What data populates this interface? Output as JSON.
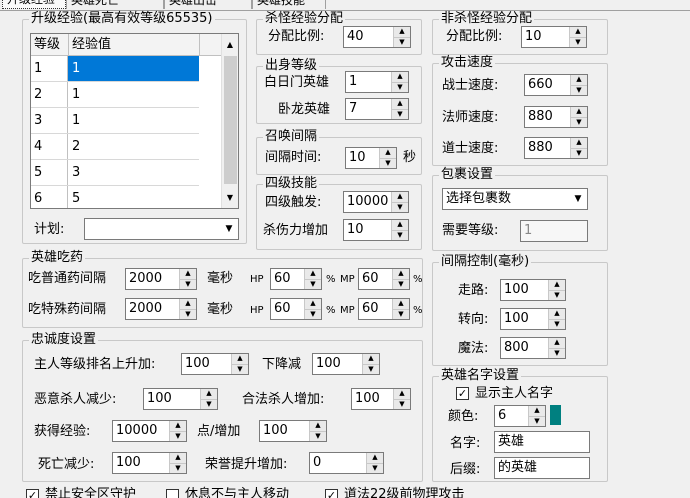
{
  "tabs": [
    "升级经验",
    "英雄死亡",
    "英雄出击",
    "英雄技能"
  ],
  "level_exp": {
    "group_label": "升级经验(最高有效等级65535)",
    "columns": [
      "等级",
      "经验值"
    ],
    "rows": [
      [
        "1",
        "1"
      ],
      [
        "2",
        "1"
      ],
      [
        "3",
        "1"
      ],
      [
        "4",
        "2"
      ],
      [
        "5",
        "3"
      ],
      [
        "6",
        "5"
      ]
    ],
    "plan_label": "计划:",
    "plan_value": ""
  },
  "kill_monster": {
    "group_label": "杀怪经验分配",
    "ratio_label": "分配比例:",
    "ratio_value": "40"
  },
  "non_kill": {
    "group_label": "非杀怪经验分配",
    "ratio_label": "分配比例:",
    "ratio_value": "10"
  },
  "origin_level": {
    "group_label": "出身等级",
    "baiyue_label": "白日门英雄",
    "baiyue_value": "1",
    "wolong_label": "卧龙英雄",
    "wolong_value": "7"
  },
  "summon": {
    "group_label": "召唤间隔",
    "interval_label": "间隔时间:",
    "interval_value": "10",
    "unit": "秒"
  },
  "skill4": {
    "group_label": "四级技能",
    "trigger_label": "四级触发:",
    "trigger_value": "10000",
    "damage_label": "杀伤力增加",
    "damage_value": "10"
  },
  "attack_speed": {
    "group_label": "攻击速度",
    "warrior_label": "战士速度:",
    "warrior_value": "660",
    "mage_label": "法师速度:",
    "mage_value": "880",
    "taoist_label": "道士速度:",
    "taoist_value": "880"
  },
  "package": {
    "group_label": "包裹设置",
    "select_value": "选择包裹数",
    "level_label": "需要等级:",
    "level_value": "1"
  },
  "potion": {
    "group_label": "英雄吃药",
    "normal_label": "吃普通药间隔",
    "normal_value": "2000",
    "special_label": "吃特殊药间隔",
    "special_value": "2000",
    "ms": "毫秒",
    "hp": "HP",
    "mp": "MP",
    "pct": "%",
    "normal_hp": "60",
    "normal_mp": "60",
    "special_hp": "60",
    "special_mp": "60"
  },
  "interval_ctrl": {
    "group_label": "间隔控制(毫秒)",
    "walk_label": "走路:",
    "walk_value": "100",
    "turn_label": "转向:",
    "turn_value": "100",
    "magic_label": "魔法:",
    "magic_value": "800"
  },
  "loyalty": {
    "group_label": "忠诚度设置",
    "rank_up_label": "主人等级排名上升加:",
    "rank_up_value": "100",
    "rank_down_label": "下降减",
    "rank_down_value": "100",
    "evil_label": "恶意杀人减少:",
    "evil_value": "100",
    "legal_label": "合法杀人增加:",
    "legal_value": "100",
    "exp_label": "获得经验:",
    "exp_value": "10000",
    "per_label": "点/增加",
    "per_value": "100",
    "death_label": "死亡减少:",
    "death_value": "100",
    "honor_label": "荣誉提升增加:",
    "honor_value": "0"
  },
  "hero_name": {
    "group_label": "英雄名字设置",
    "show_label": "显示主人名字",
    "color_label": "颜色:",
    "color_value": "6",
    "color_hex": "#008080",
    "name_label": "名字:",
    "name_value": "英雄",
    "suffix_label": "后缀:",
    "suffix_value": "的英雄"
  },
  "bottom": {
    "safe_zone": "禁止安全区守护",
    "rest_no_follow": "休息不与主人移动",
    "physical_attack": "道法22级前物理攻击"
  }
}
